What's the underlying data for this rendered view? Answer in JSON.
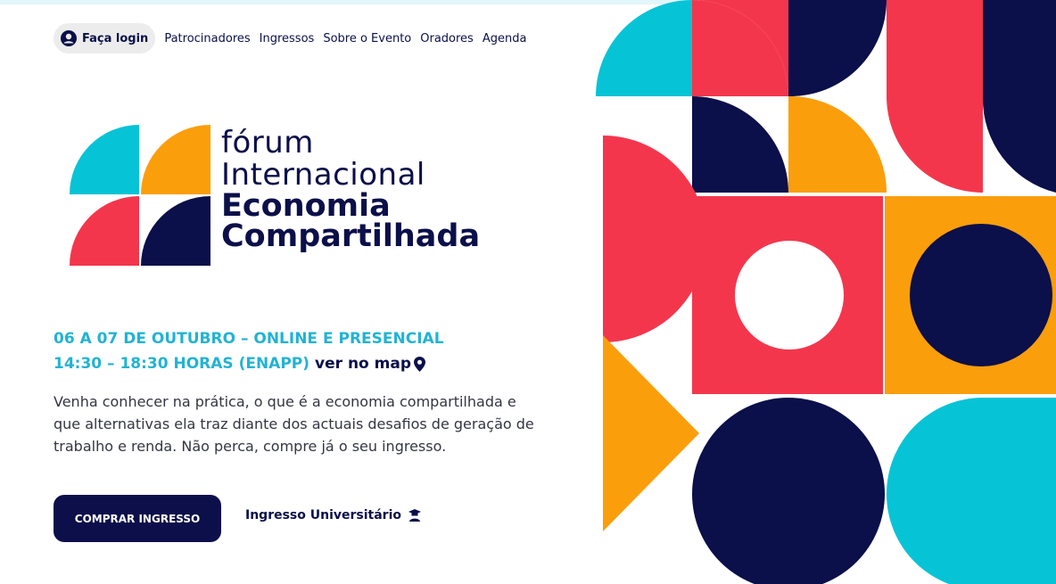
{
  "nav": {
    "login_label": "Faça login",
    "links": [
      "Patrocinadores",
      "Ingressos",
      "Sobre o Evento",
      "Oradores",
      "Agenda"
    ]
  },
  "logo": {
    "line1": "fórum",
    "line2": "Internacional",
    "line3": "Economia",
    "line4": "Compartilhada"
  },
  "event": {
    "date_text": "06 A 07 DE OUTUBRO – ONLINE E PRESENCIAL",
    "time_text": "14:30 – 18:30 HORAS (ENAPP)",
    "map_link": "ver no map"
  },
  "description": "Venha conhecer na prática, o que é a economia compartilhada e que alternativas ela traz diante dos actuais desafios de geração de trabalho e renda. Não perca, compre já o seu ingresso.",
  "cta": {
    "buy_label": "COMPRAR INGRESSO",
    "student_label": "Ingresso Universitário"
  },
  "colors": {
    "navy": "#0b0f4a",
    "teal": "#22b3d3",
    "red": "#f4364c",
    "orange": "#fb9e0b",
    "cyan": "#07c3d6"
  },
  "icons": [
    "user-circle-icon",
    "map-pin-icon",
    "graduate-icon"
  ]
}
